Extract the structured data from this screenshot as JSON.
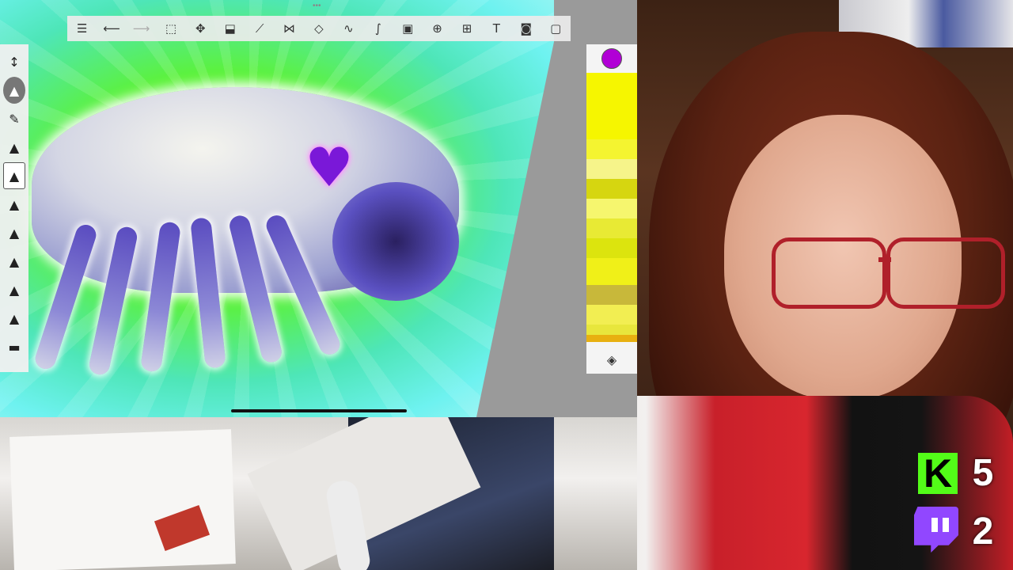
{
  "toolbar": {
    "buttons": [
      {
        "icon": "menu-list-icon",
        "glyph": "☰"
      },
      {
        "icon": "undo-icon",
        "glyph": "⟵"
      },
      {
        "icon": "redo-icon",
        "glyph": "⟶"
      },
      {
        "icon": "selection-icon",
        "glyph": "⬚"
      },
      {
        "icon": "transform-icon",
        "glyph": "✥"
      },
      {
        "icon": "fill-bucket-icon",
        "glyph": "⬓"
      },
      {
        "icon": "ruler-icon",
        "glyph": "⟋"
      },
      {
        "icon": "symmetry-icon",
        "glyph": "⋈"
      },
      {
        "icon": "shapes-icon",
        "glyph": "◇"
      },
      {
        "icon": "curve-icon",
        "glyph": "∿"
      },
      {
        "icon": "stroke-icon",
        "glyph": "∫"
      },
      {
        "icon": "image-icon",
        "glyph": "▣"
      },
      {
        "icon": "perspective-icon",
        "glyph": "⊕"
      },
      {
        "icon": "import-icon",
        "glyph": "⊞"
      },
      {
        "icon": "text-icon",
        "glyph": "T"
      },
      {
        "icon": "timelapse-icon",
        "glyph": "◙"
      },
      {
        "icon": "fullscreen-icon",
        "glyph": "▢"
      }
    ]
  },
  "brushes": [
    {
      "icon": "brush-size-slider-icon",
      "glyph": "↕",
      "state": "none"
    },
    {
      "icon": "airbrush-icon",
      "glyph": "▲",
      "state": "round"
    },
    {
      "icon": "pencil-icon",
      "glyph": "✎",
      "state": "none"
    },
    {
      "icon": "marker-icon",
      "glyph": "▲",
      "state": "none"
    },
    {
      "icon": "ink-pen-icon",
      "glyph": "▲",
      "state": "square"
    },
    {
      "icon": "paint-brush-icon",
      "glyph": "▲",
      "state": "none"
    },
    {
      "icon": "highlighter-icon",
      "glyph": "▲",
      "state": "none"
    },
    {
      "icon": "fineliner-icon",
      "glyph": "▲",
      "state": "none"
    },
    {
      "icon": "felt-pen-icon",
      "glyph": "▲",
      "state": "none"
    },
    {
      "icon": "soft-eraser-icon",
      "glyph": "▲",
      "state": "none"
    },
    {
      "icon": "smudge-icon",
      "glyph": "▬",
      "state": "none"
    }
  ],
  "color_panel": {
    "current_color": "#b100d6",
    "swatches": [
      {
        "color": "#f6f600",
        "weight": 5
      },
      {
        "color": "#f4f430",
        "weight": 1.5
      },
      {
        "color": "#f6f48a",
        "weight": 1.5
      },
      {
        "color": "#d6d610",
        "weight": 1.5
      },
      {
        "color": "#f6f66e",
        "weight": 1.5
      },
      {
        "color": "#e8ea34",
        "weight": 1.5
      },
      {
        "color": "#dce40e",
        "weight": 1.5
      },
      {
        "color": "#f0f018",
        "weight": 2
      },
      {
        "color": "#c8b83a",
        "weight": 1.5
      },
      {
        "color": "#f2ee52",
        "weight": 1.5
      },
      {
        "color": "#e8e63c",
        "weight": 0.8
      },
      {
        "color": "#e8b010",
        "weight": 0.5
      }
    ],
    "layers_icon": "layers-icon",
    "layers_glyph": "◈"
  },
  "canvas": {
    "heart_glyph": "♥",
    "heart_color": "#7a18d8"
  },
  "overlay": {
    "kick_letter": "K",
    "kick_count": "5",
    "twitch_count": "2",
    "kick_color": "#53fc18",
    "twitch_color": "#9147ff"
  }
}
